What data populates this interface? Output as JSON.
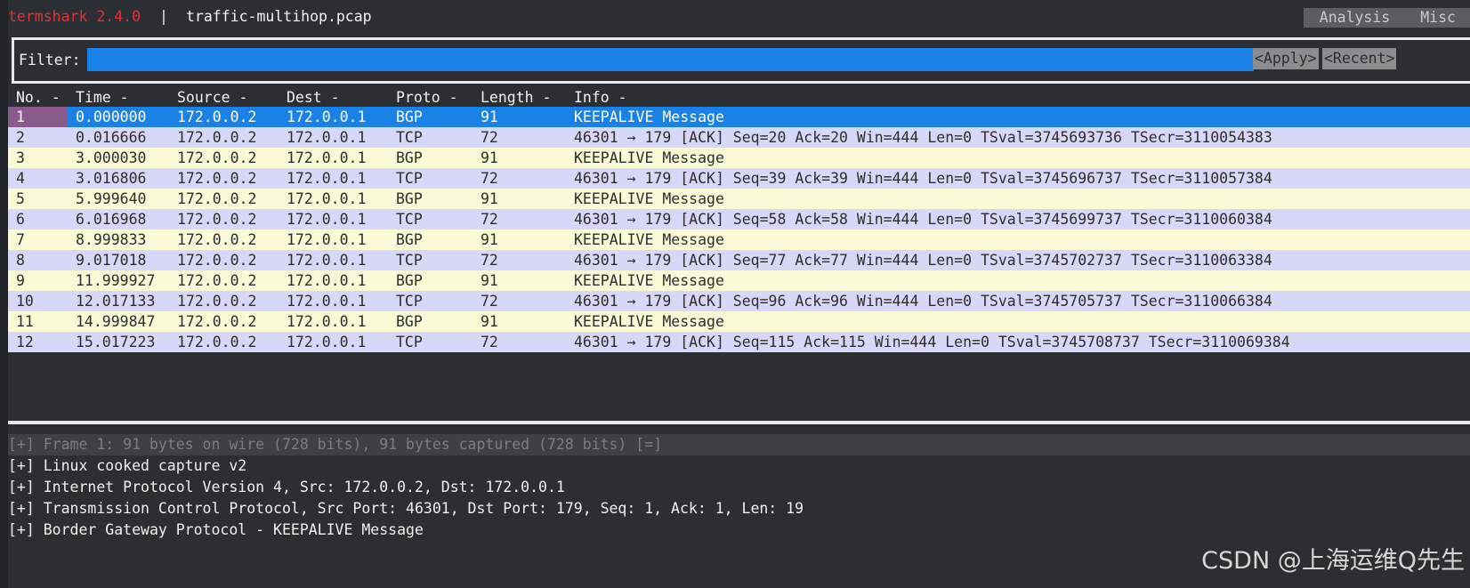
{
  "titlebar": {
    "app": "termshark 2.4.0",
    "sep": "|",
    "file": "traffic-multihop.pcap",
    "menu": [
      "Analysis",
      "Misc"
    ]
  },
  "filter": {
    "label": "Filter:",
    "value": "",
    "apply": "<Apply>",
    "recent": "<Recent>"
  },
  "table": {
    "headers": [
      "No. -",
      "Time -",
      "Source -",
      "Dest -",
      "Proto -",
      "Length -",
      "Info -"
    ],
    "rows": [
      [
        "1",
        "0.000000",
        "172.0.0.2",
        "172.0.0.1",
        "BGP",
        "91",
        "KEEPALIVE Message"
      ],
      [
        "2",
        "0.016666",
        "172.0.0.2",
        "172.0.0.1",
        "TCP",
        "72",
        "46301 → 179 [ACK] Seq=20 Ack=20 Win=444 Len=0 TSval=3745693736 TSecr=3110054383"
      ],
      [
        "3",
        "3.000030",
        "172.0.0.2",
        "172.0.0.1",
        "BGP",
        "91",
        "KEEPALIVE Message"
      ],
      [
        "4",
        "3.016806",
        "172.0.0.2",
        "172.0.0.1",
        "TCP",
        "72",
        "46301 → 179 [ACK] Seq=39 Ack=39 Win=444 Len=0 TSval=3745696737 TSecr=3110057384"
      ],
      [
        "5",
        "5.999640",
        "172.0.0.2",
        "172.0.0.1",
        "BGP",
        "91",
        "KEEPALIVE Message"
      ],
      [
        "6",
        "6.016968",
        "172.0.0.2",
        "172.0.0.1",
        "TCP",
        "72",
        "46301 → 179 [ACK] Seq=58 Ack=58 Win=444 Len=0 TSval=3745699737 TSecr=3110060384"
      ],
      [
        "7",
        "8.999833",
        "172.0.0.2",
        "172.0.0.1",
        "BGP",
        "91",
        "KEEPALIVE Message"
      ],
      [
        "8",
        "9.017018",
        "172.0.0.2",
        "172.0.0.1",
        "TCP",
        "72",
        "46301 → 179 [ACK] Seq=77 Ack=77 Win=444 Len=0 TSval=3745702737 TSecr=3110063384"
      ],
      [
        "9",
        "11.999927",
        "172.0.0.2",
        "172.0.0.1",
        "BGP",
        "91",
        "KEEPALIVE Message"
      ],
      [
        "10",
        "12.017133",
        "172.0.0.2",
        "172.0.0.1",
        "TCP",
        "72",
        "46301 → 179 [ACK] Seq=96 Ack=96 Win=444 Len=0 TSval=3745705737 TSecr=3110066384"
      ],
      [
        "11",
        "14.999847",
        "172.0.0.2",
        "172.0.0.1",
        "BGP",
        "91",
        "KEEPALIVE Message"
      ],
      [
        "12",
        "15.017223",
        "172.0.0.2",
        "172.0.0.1",
        "TCP",
        "72",
        "46301 → 179 [ACK] Seq=115 Ack=115 Win=444 Len=0 TSval=3745708737 TSecr=3110069384"
      ]
    ]
  },
  "details": [
    "[+] Frame 1: 91 bytes on wire (728 bits), 91 bytes captured (728 bits) [=]",
    "[+] Linux cooked capture v2",
    "[+] Internet Protocol Version 4, Src: 172.0.0.2, Dst: 172.0.0.1",
    "[+] Transmission Control Protocol, Src Port: 46301, Dst Port: 179, Seq: 1, Ack: 1, Len: 19",
    "[+] Border Gateway Protocol - KEEPALIVE Message"
  ],
  "watermark": "CSDN @上海运维Q先生",
  "colors": {
    "background": "#2b2f33",
    "accent": "#1a82e6",
    "app_name": "#e0323a",
    "row_even": "#d7d8f7",
    "row_odd": "#fafad6"
  }
}
